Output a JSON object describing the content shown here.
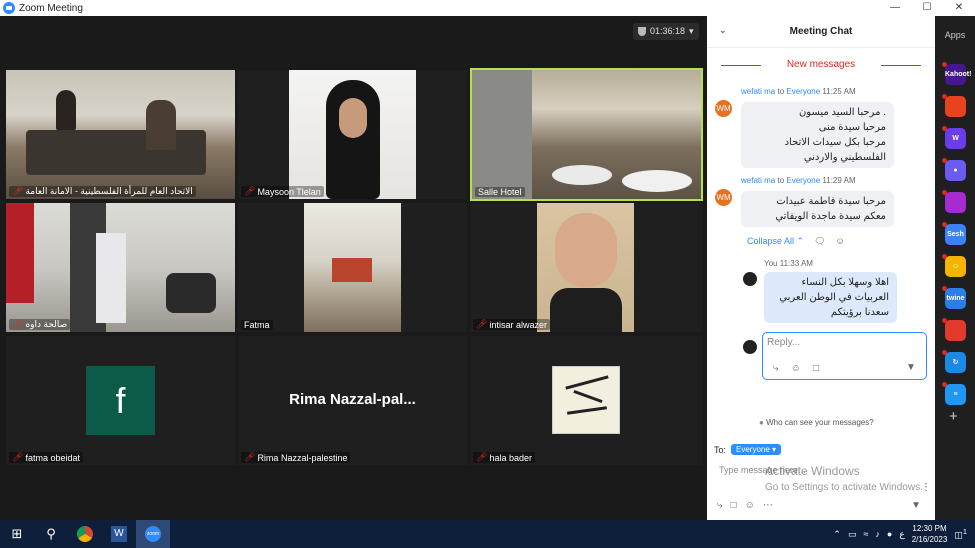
{
  "window": {
    "title": "Zoom Meeting",
    "controls": [
      "—",
      "☐",
      "✕"
    ]
  },
  "timer": {
    "value": "01:36:18",
    "caret": "▾"
  },
  "participants": [
    {
      "name": "الاتحاد العام للمرأة الفلسطينية - الامانة العامة",
      "muted": true
    },
    {
      "name": "Maysoon Tlelan",
      "muted": true
    },
    {
      "name": "Salle Hotel",
      "muted": false,
      "active_speaker": true
    },
    {
      "name": "صالحة داوه",
      "muted": true
    },
    {
      "name": "Fatma",
      "muted": false
    },
    {
      "name": "intisar alwazer",
      "muted": true
    },
    {
      "name": "fatma obeidat",
      "muted": true,
      "avatar_letter": "f"
    },
    {
      "name": "Rima Nazzal-palestine",
      "muted": true,
      "display_name": "Rima  Nazzal-pal..."
    },
    {
      "name": "hala bader",
      "muted": true
    }
  ],
  "chat": {
    "title": "Meeting Chat",
    "new_messages": "New messages",
    "messages": [
      {
        "initials": "WM",
        "sender": "wefati ma",
        "to_word": "to",
        "to": "Everyone",
        "time": "11:25 AM",
        "lines": [
          ". مرحبا السيد ميسون",
          "مرحبا سيدة منى",
          "مرحبا بكل سيدات الاتحاد",
          "الفلسطيني والاردني"
        ]
      },
      {
        "initials": "WM",
        "sender": "wefati ma",
        "to_word": "to",
        "to": "Everyone",
        "time": "11:29 AM",
        "lines": [
          "مرحبا سيدة فاطمة عبيدات",
          "معكم سيدة ماجدة الويفاتي"
        ]
      },
      {
        "sender": "You",
        "time": "11:33 AM",
        "lines": [
          "اهلا وسهلا بكل النساء",
          "العربيات في الوطن العربي",
          "سعدنا برؤيتكم"
        ]
      }
    ],
    "collapse_label": "Collapse All",
    "reply_placeholder": "Reply...",
    "who_can_see": "Who can see your messages?",
    "to_label": "To:",
    "to_value": "Everyone",
    "type_placeholder": "Type message here...",
    "watermark_1": "Activate Windows",
    "watermark_2": "Go to Settings to activate Windows."
  },
  "apps": {
    "label": "Apps",
    "items": [
      {
        "icon": "kahoot-icon",
        "text": "Kahoot!",
        "color": "#46178f"
      },
      {
        "icon": "red-app-icon",
        "text": "",
        "color": "#e8431f"
      },
      {
        "icon": "w-app-icon",
        "text": "W",
        "color": "#6a3de8"
      },
      {
        "icon": "circle-app-icon",
        "text": "●",
        "color": "#6a5cf0"
      },
      {
        "icon": "stripes-app-icon",
        "text": "",
        "color": "#a62ccf"
      },
      {
        "icon": "sesh-icon",
        "text": "Sesh",
        "color": "#3b82f6"
      },
      {
        "icon": "smiley-app-icon",
        "text": "☺",
        "color": "#f5b400"
      },
      {
        "icon": "twine-icon",
        "text": "twine",
        "color": "#2b7de9"
      },
      {
        "icon": "grid-app-icon",
        "text": "",
        "color": "#e23b2e"
      },
      {
        "icon": "sync-app-icon",
        "text": "↻",
        "color": "#1e88e5"
      },
      {
        "icon": "stack-app-icon",
        "text": "≡",
        "color": "#2196f3"
      }
    ],
    "add": "+"
  },
  "taskbar": {
    "time": "12:30 PM",
    "date": "2/16/2023",
    "lang": "ع",
    "notifications": "1"
  }
}
